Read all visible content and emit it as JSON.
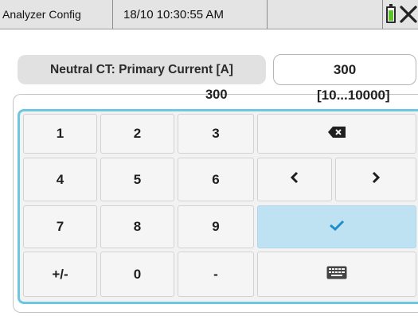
{
  "titlebar": {
    "app_name": "Analyzer Config",
    "datetime": "18/10 10:30:55 AM",
    "battery_icon": "battery-icon",
    "close_icon": "close-icon",
    "battery_color": "#5ec22a"
  },
  "parameter": {
    "label": "Neutral CT: Primary Current [A]",
    "value": "300"
  },
  "keypad": {
    "entry_value": "300",
    "range": "[10...10000]",
    "accent_color": "#6ec7df",
    "keys": {
      "k1": "1",
      "k2": "2",
      "k3": "3",
      "k4": "4",
      "k5": "5",
      "k6": "6",
      "k7": "7",
      "k8": "8",
      "k9": "9",
      "sign": "+/-",
      "k0": "0",
      "minus": "-"
    },
    "icons": {
      "backspace": "backspace-icon",
      "left": "arrow-left-icon",
      "right": "arrow-right-icon",
      "confirm": "check-icon",
      "keyboard": "keyboard-icon"
    }
  }
}
